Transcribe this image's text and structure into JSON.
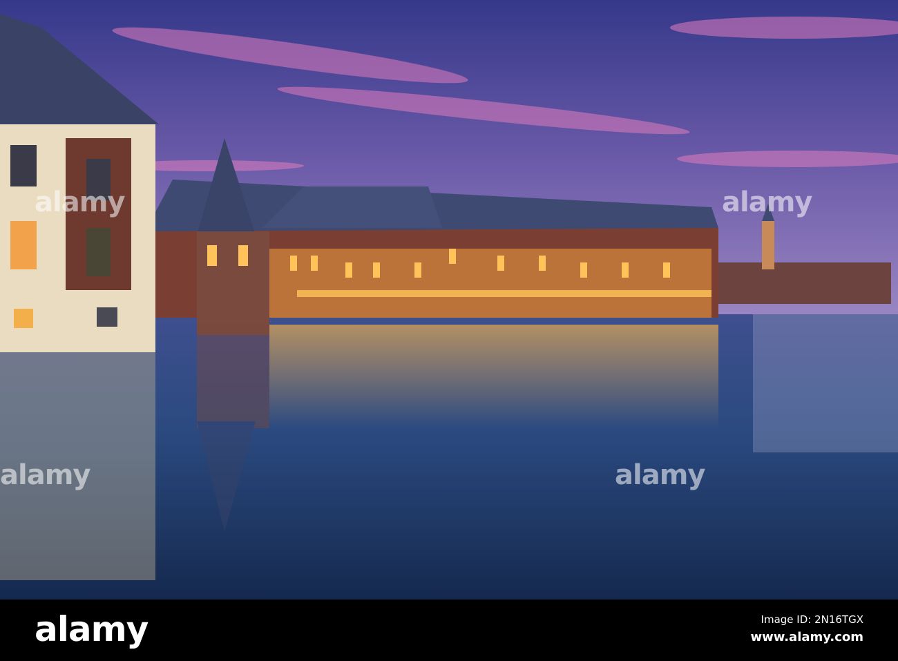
{
  "watermark": {
    "text": "alamy"
  },
  "footer": {
    "logo": "alamy",
    "image_id": "Image ID: 2N16TGX",
    "url": "www.alamy.com"
  },
  "colors": {
    "sky_top": "#3b3f8f",
    "sky_pink": "#d07ab8",
    "water": "#1f3a6a",
    "lights": "#f3b24a"
  }
}
